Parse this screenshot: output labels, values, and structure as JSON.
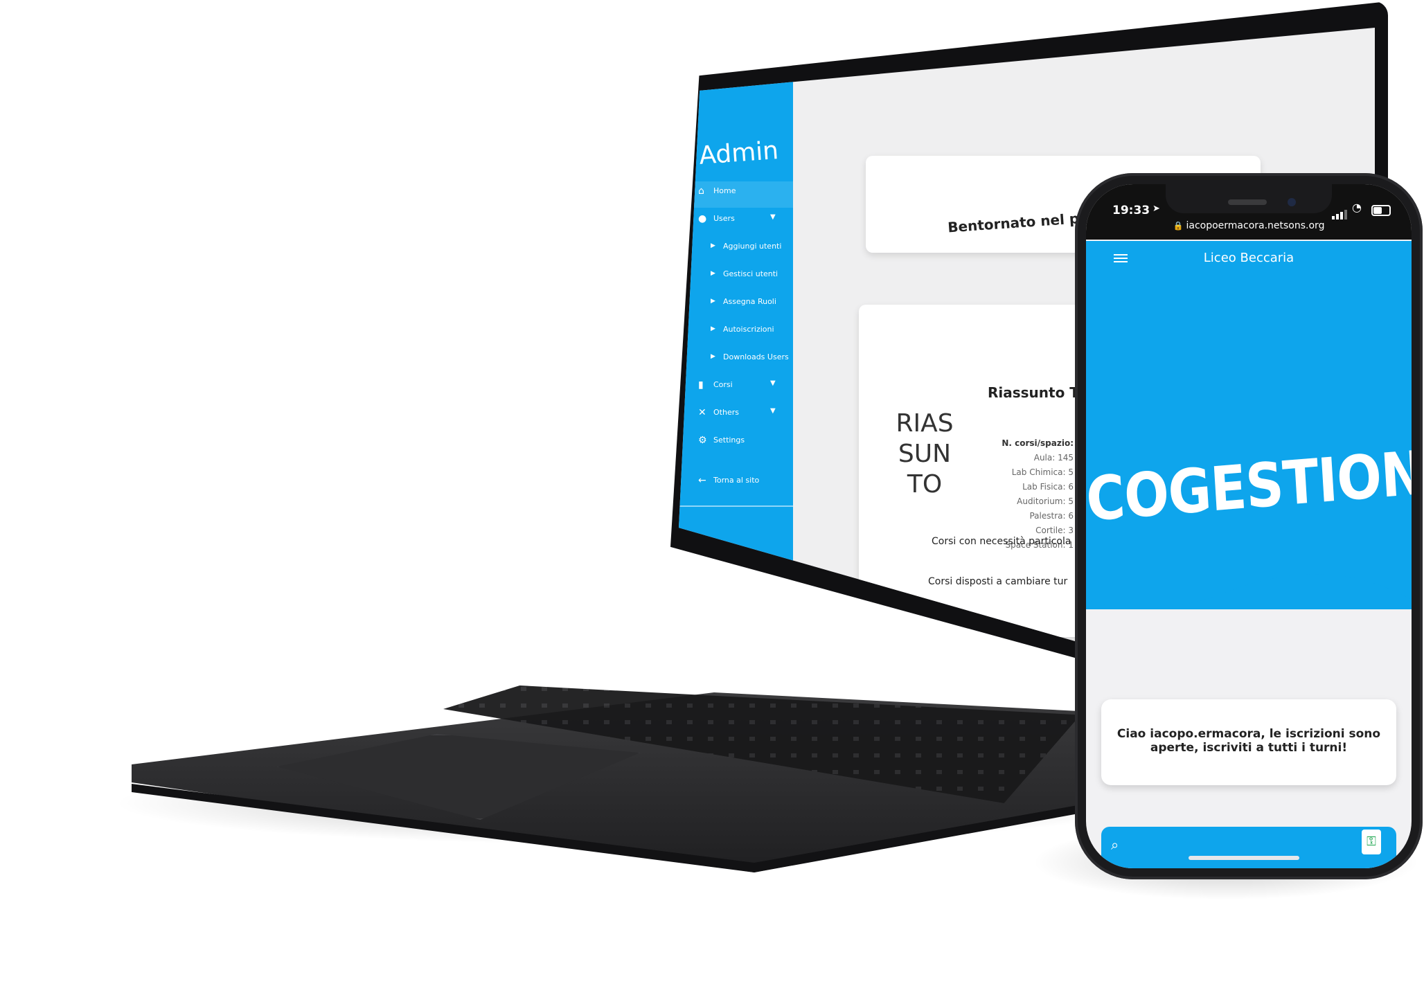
{
  "laptop": {
    "sidebar": {
      "title": "Admin",
      "items": [
        {
          "label": "Home",
          "icon": "home-icon"
        },
        {
          "label": "Users",
          "icon": "user-icon",
          "expanded": true
        },
        {
          "label": "Aggiungi utenti",
          "icon": "caret-right-icon"
        },
        {
          "label": "Gestisci utenti",
          "icon": "caret-right-icon"
        },
        {
          "label": "Assegna Ruoli",
          "icon": "caret-right-icon"
        },
        {
          "label": "Autoiscrizioni",
          "icon": "caret-right-icon"
        },
        {
          "label": "Downloads Users",
          "icon": "caret-right-icon"
        },
        {
          "label": "Corsi",
          "icon": "book-icon"
        },
        {
          "label": "Others",
          "icon": "tools-icon"
        },
        {
          "label": "Settings",
          "icon": "gear-icon"
        },
        {
          "label": "Torna al sito",
          "icon": "arrow-left-icon"
        }
      ]
    },
    "welcome": "Bentornato nel pannello",
    "summary": {
      "title": "Riassunto To",
      "logo_lines": [
        "RIAS",
        "SUN",
        "TO"
      ],
      "stats_heading": "N. corsi/spazio:",
      "stats": [
        "Aula: 145",
        "Lab Chimica: 5",
        "Lab Fisica: 6",
        "Auditorium: 5",
        "Palestra: 6",
        "Cortile: 3",
        "Space Station: 1"
      ],
      "special_needs": "Corsi con necessità particola",
      "shift_change": "Corsi disposti a cambiare tur"
    }
  },
  "phone": {
    "time": "19:33",
    "url": "iacopoermacora.netsons.org",
    "app_title": "Liceo Beccaria",
    "hero_title": "COGESTIONE",
    "greeting": "Ciao iacopo.ermacora, le iscrizioni sono aperte, iscriviti a tutti i turni!"
  },
  "colors": {
    "brand": "#0ea5ec",
    "device": "#1b1b1d"
  }
}
